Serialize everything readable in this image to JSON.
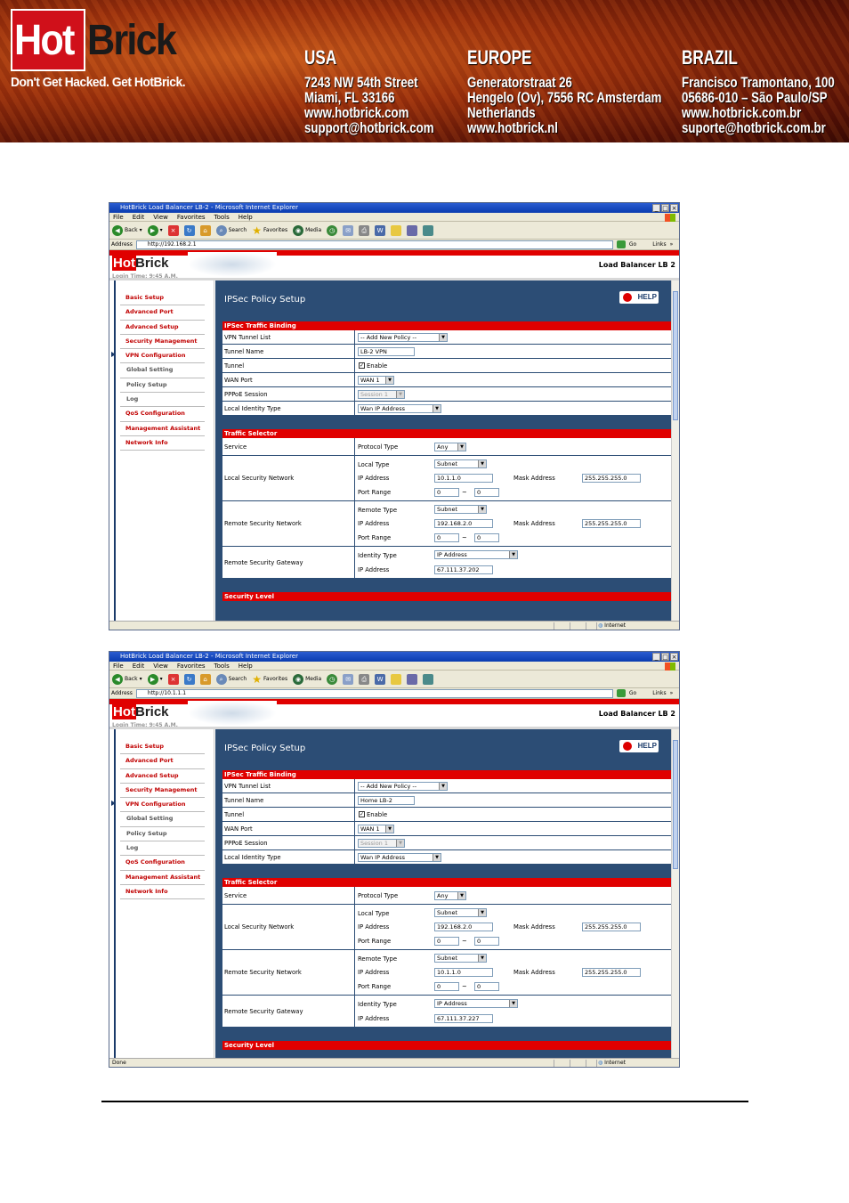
{
  "banner": {
    "logo_hot": "Hot",
    "logo_brick": "Brick",
    "tagline": "Don't Get Hacked. Get HotBrick.",
    "usa": {
      "title": "USA",
      "lines": [
        "7243 NW 54th Street",
        "Miami, FL 33166",
        "www.hotbrick.com",
        "support@hotbrick.com"
      ]
    },
    "europe": {
      "title": "EUROPE",
      "lines": [
        "Generatorstraat 26",
        "Hengelo (Ov), 7556 RC Amsterdam",
        "Netherlands",
        "www.hotbrick.nl"
      ]
    },
    "brazil": {
      "title": "BRAZIL",
      "lines": [
        "Francisco Tramontano, 100",
        "05686-010 – São Paulo/SP",
        "www.hotbrick.com.br",
        "suporte@hotbrick.com.br"
      ]
    }
  },
  "browser": {
    "title": "HotBrick Load Balancer LB-2 - Microsoft Internet Explorer",
    "menu": [
      "File",
      "Edit",
      "View",
      "Favorites",
      "Tools",
      "Help"
    ],
    "toolbar": {
      "back": "Back",
      "search": "Search",
      "favorites": "Favorites",
      "media": "Media"
    },
    "address_label": "Address",
    "go": "Go",
    "links": "Links",
    "internet": "Internet"
  },
  "app": {
    "hot": "Hot",
    "brick": "Brick",
    "device": "Load Balancer LB 2",
    "login_time": "Login Time: 9:45 A.M.",
    "help": "HELP",
    "page_title": "IPSec Policy Setup",
    "nav": [
      "Basic Setup",
      "Advanced Port",
      "Advanced Setup",
      "Security Management",
      "VPN Configuration",
      "Global Setting",
      "Policy Setup",
      "Log",
      "QoS Configuration",
      "Management Assistant",
      "Network Info"
    ],
    "sections": {
      "binding": "IPSec Traffic Binding",
      "selector": "Traffic Selector",
      "level": "Security Level"
    },
    "labels": {
      "vpn_list": "VPN Tunnel List",
      "tunnel_name": "Tunnel Name",
      "tunnel": "Tunnel",
      "wan_port": "WAN Port",
      "pppoe": "PPPoE Session",
      "local_id": "Local Identity Type",
      "service": "Service",
      "local_net": "Local Security Network",
      "remote_net": "Remote Security Network",
      "remote_gw": "Remote Security Gateway",
      "protocol_type": "Protocol Type",
      "local_type": "Local Type",
      "remote_type": "Remote Type",
      "ip_address": "IP Address",
      "mask_address": "Mask Address",
      "port_range": "Port Range",
      "identity_type": "Identity Type",
      "enable": "Enable"
    },
    "values": {
      "vpn_list": "-- Add New Policy --",
      "wan_port": "WAN 1",
      "pppoe": "Session 1",
      "local_id": "Wan IP Address",
      "protocol": "Any",
      "subnet": "Subnet",
      "identity": "IP Address",
      "tilde": "~"
    }
  },
  "shot1": {
    "url": "http://192.168.2.1",
    "status": "",
    "tunnel_name": "LB-2 VPN",
    "local_ip": "10.1.1.0",
    "local_mask": "255.255.255.0",
    "local_port_from": "0",
    "local_port_to": "0",
    "remote_ip": "192.168.2.0",
    "remote_mask": "255.255.255.0",
    "remote_port_from": "0",
    "remote_port_to": "0",
    "gateway_ip": "67.111.37.202"
  },
  "shot2": {
    "url": "http://10.1.1.1",
    "status": "Done",
    "tunnel_name": "Home LB-2",
    "local_ip": "192.168.2.0",
    "local_mask": "255.255.255.0",
    "local_port_from": "0",
    "local_port_to": "0",
    "remote_ip": "10.1.1.0",
    "remote_mask": "255.255.255.0",
    "remote_port_from": "0",
    "remote_port_to": "0",
    "gateway_ip": "67.111.37.227"
  },
  "colors": {
    "accent_red": "#e00000",
    "content_blue": "#2c4d75"
  }
}
